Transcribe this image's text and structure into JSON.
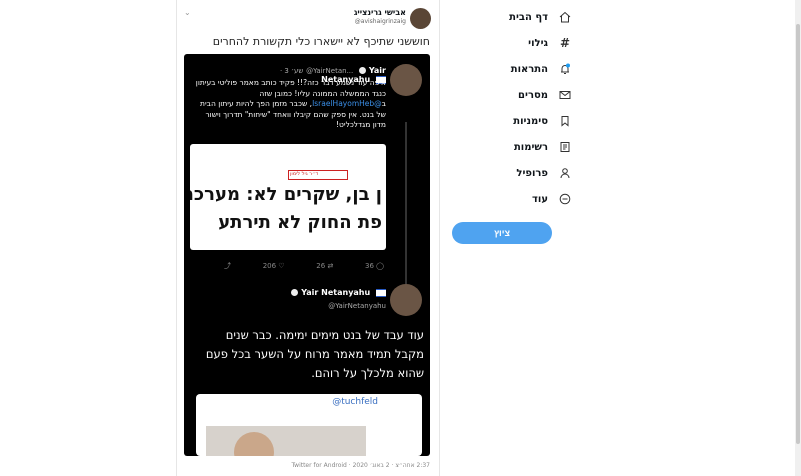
{
  "sidebar": {
    "items": [
      {
        "label": "דף הבית",
        "icon": "home-icon"
      },
      {
        "label": "גילוי",
        "icon": "hashtag-icon"
      },
      {
        "label": "התראות",
        "icon": "bell-icon"
      },
      {
        "label": "מסרים",
        "icon": "mail-icon"
      },
      {
        "label": "סימניות",
        "icon": "bookmark-icon"
      },
      {
        "label": "רשימות",
        "icon": "list-icon"
      },
      {
        "label": "פרופיל",
        "icon": "profile-icon"
      },
      {
        "label": "עוד",
        "icon": "more-icon"
      }
    ],
    "tweet_button": "ציוץ",
    "accent": "#4fa3f0"
  },
  "tweet": {
    "author_name": "אבישי גרינצייג",
    "author_handle": "@avishaigrinzaig",
    "text": "חוששני שתיכף לא יישארו כלי תקשורת להחרים",
    "footer": "2:37 אחה״צ · 2 באוג׳ 2020 · Twitter for Android"
  },
  "screenshot": {
    "first": {
      "name": "Yair Netanyahu",
      "handle": "@YairNetan...",
      "time": "· 3 שע׳",
      "text": "איפה עוד נשמע דבר כזה?!! פקיד כותב מאמר פוליטי בעיתון כנגד הממשלה הממונה עליו! כמובן שזה ב",
      "link": "@IsraelHayomHeb",
      "text_after": ", שכבר מזמן הפך להיות עיתון הבית של בנט. אין ספק שהם קיבלו וואחד \"שיחות\" תדרוך וישור מדון מגדלכליט!",
      "image_red_label": "ד״ר גיל לימון",
      "image_headline_1": "ן בן, שקרים לא: מערכת",
      "image_headline_2": "פת החוק לא תירתע",
      "replies": "36",
      "retweets": "26",
      "likes": "206"
    },
    "second": {
      "name": "Yair Netanyahu",
      "handle": "@YairNetanyahu",
      "text": "עוד עבד של בנט מימים ימימה. כבר שנים מקבל תמיד מאמר מרוח על השער בכל פעם שהוא מלכלך על רוהם.",
      "image_tag": "@tuchfeld"
    }
  }
}
